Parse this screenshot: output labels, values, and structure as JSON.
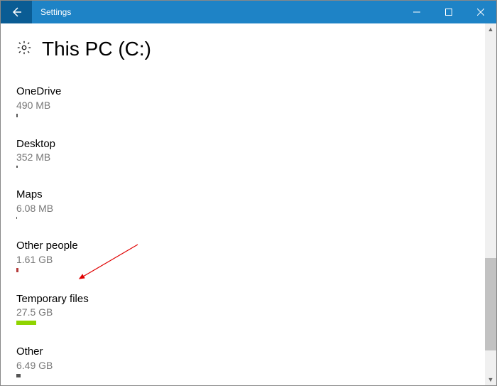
{
  "titlebar": {
    "app_name": "Settings"
  },
  "header": {
    "title": "This PC (C:)"
  },
  "categories": [
    {
      "name": "OneDrive",
      "size": "490 MB",
      "bar_class": "bar-onedrive"
    },
    {
      "name": "Desktop",
      "size": "352 MB",
      "bar_class": "bar-desktop"
    },
    {
      "name": "Maps",
      "size": "6.08 MB",
      "bar_class": "bar-maps"
    },
    {
      "name": "Other people",
      "size": "1.61 GB",
      "bar_class": "bar-people"
    },
    {
      "name": "Temporary files",
      "size": "27.5 GB",
      "bar_class": "bar-temp"
    },
    {
      "name": "Other",
      "size": "6.49 GB",
      "bar_class": "bar-other"
    }
  ]
}
